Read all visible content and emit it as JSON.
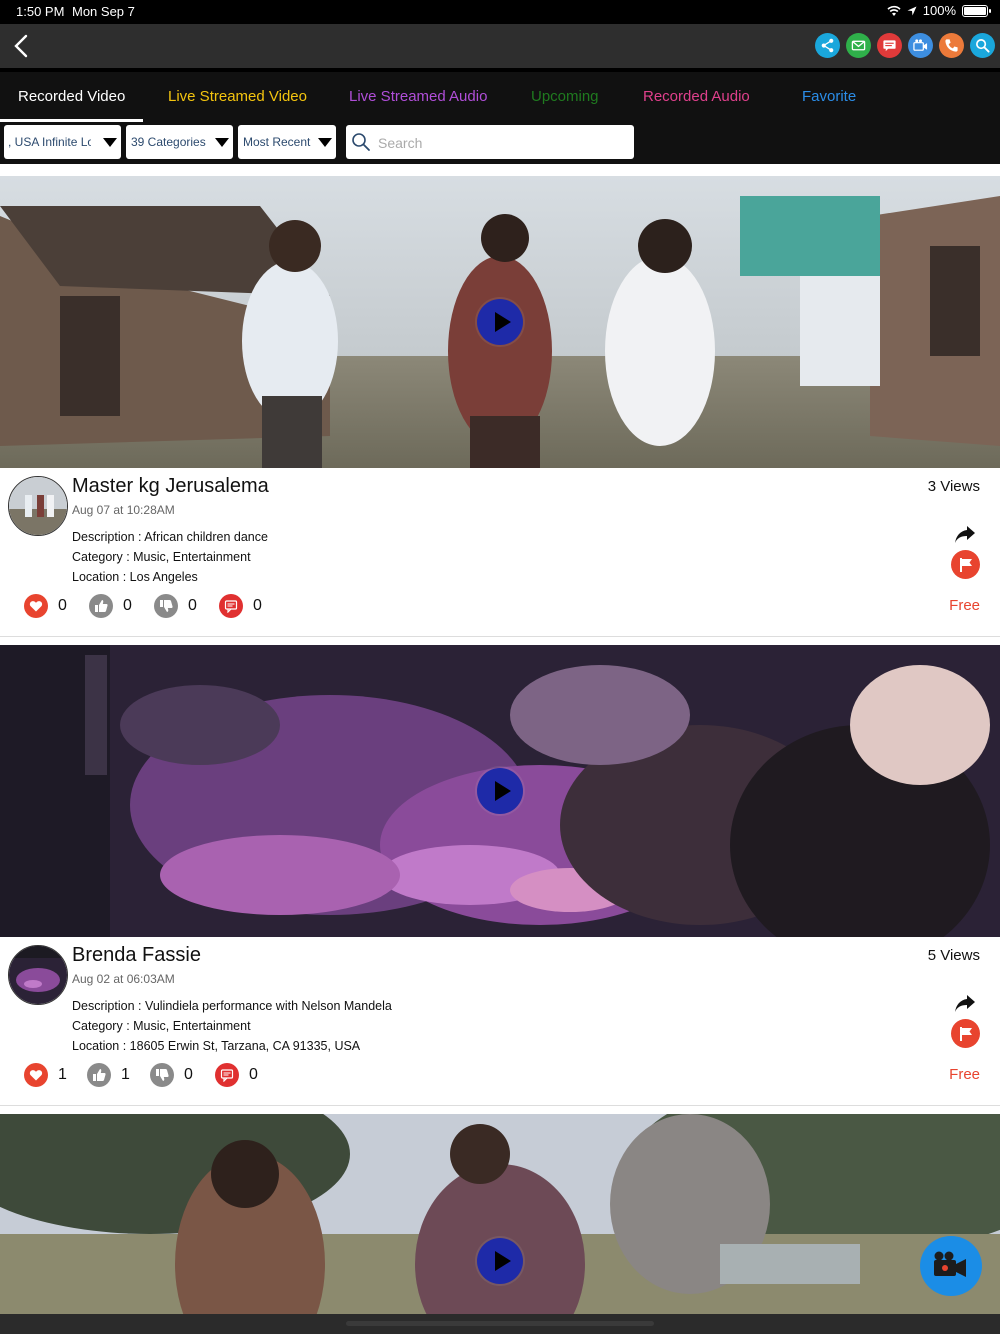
{
  "status_bar": {
    "time": "1:50 PM",
    "date": "Mon Sep 7",
    "battery": "100%"
  },
  "nav": {
    "actions": [
      {
        "name": "share-icon",
        "color": "#1aa7dc"
      },
      {
        "name": "email-icon",
        "color": "#2fb04a"
      },
      {
        "name": "chat-icon",
        "color": "#e03a3a"
      },
      {
        "name": "video-call-icon",
        "color": "#3d8ee0"
      },
      {
        "name": "phone-icon",
        "color": "#ec7a3a"
      },
      {
        "name": "search-icon",
        "color": "#1aa7dc"
      }
    ]
  },
  "tabs": [
    {
      "label": "Recorded Video",
      "color": "#ffffff",
      "active": true
    },
    {
      "label": "Live Streamed Video",
      "color": "#f3c40f"
    },
    {
      "label": "Live Streamed Audio",
      "color": "#b04ed8"
    },
    {
      "label": "Upcoming",
      "color": "#1f7a1f"
    },
    {
      "label": "Recorded Audio",
      "color": "#e0408c"
    },
    {
      "label": "Favorite",
      "color": "#2b8de8"
    }
  ],
  "filters": {
    "location": ", USA  Infinite Loop",
    "category": "39 Categories",
    "sort": "Most Recent",
    "search_placeholder": "Search"
  },
  "videos": [
    {
      "title": "Master kg Jerusalema",
      "date": "Aug 07 at 10:28AM",
      "views": "3 Views",
      "description": "Description : African children dance",
      "category": "Category : Music, Entertainment",
      "location": "Location : Los Angeles",
      "likes": "0",
      "thumbs_up": "0",
      "thumbs_down": "0",
      "comments": "0",
      "price": "Free"
    },
    {
      "title": "Brenda Fassie",
      "date": "Aug 02 at 06:03AM",
      "views": "5 Views",
      "description": "Description : Vulindiela performance with Nelson Mandela",
      "category": "Category : Music, Entertainment",
      "location": "Location : 18605 Erwin St, Tarzana, CA 91335, USA",
      "likes": "1",
      "thumbs_up": "1",
      "thumbs_down": "0",
      "comments": "0",
      "price": "Free"
    }
  ],
  "colors": {
    "heart": "#e8442f",
    "neutral": "#8a8a8a",
    "comment": "#e03030",
    "price": "#e8442f",
    "fab": "#1b8de6"
  }
}
